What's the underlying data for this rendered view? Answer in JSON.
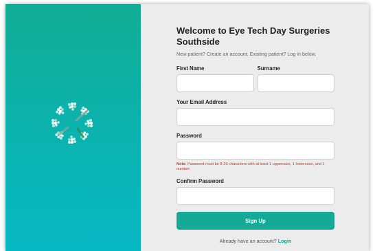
{
  "form": {
    "title": "Welcome to Eye Tech Day Surgeries Southside",
    "subtitle": "New patient? Create an account. Existing patient? Log in below.",
    "first_name_label": "First Name",
    "surname_label": "Surname",
    "email_label": "Your Email Address",
    "password_label": "Password",
    "note_prefix": "Note:",
    "note_text": " Password must be 8-20 characters with at least 1 uppercase, 1 lowercase, and 1 number.",
    "confirm_label": "Confirm Password",
    "signup_label": "Sign Up",
    "footer_text": "Already have an account? ",
    "login_link": "Login"
  },
  "colors": {
    "accent": "#15aa98",
    "panel_top": "#12ad94",
    "panel_bottom": "#06b7c2",
    "note": "#c0392b"
  },
  "icons": {
    "logo": "pinwheel-logo-icon"
  }
}
